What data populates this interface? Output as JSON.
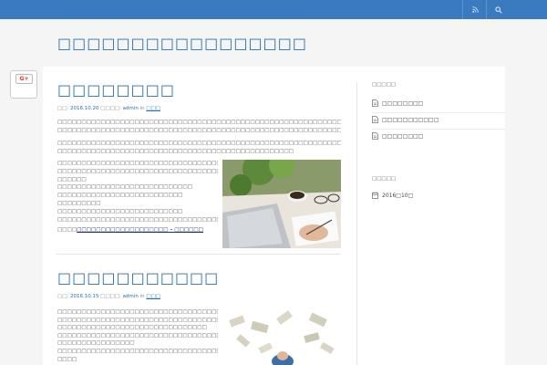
{
  "topbar": {
    "rss_icon": "rss-icon",
    "search_icon": "search-icon"
  },
  "site": {
    "title": "□□□□□□□□□□□□□□□□□"
  },
  "social": {
    "gplus_label": "G+"
  },
  "posts": [
    {
      "title": "□□□□□□□□",
      "date": "2016.10.20",
      "author": "admin",
      "meta_sep": "□□□□:",
      "meta_in": "in",
      "category": "□□□",
      "para1": [
        "□□□□□□□□□□□□□□□□□□□□□□□□□□□□□□□□□□□□□□□□□□□□□□□□□□□□□□□□□□□□□□□□□□□□□□□□□□□□□□□□□□□□",
        "□□□□□□□□□□□□□□□□□□□□□□□□□□□□□□□□□□□□□□□□□□□□□□□□□□□□□□□□□□□□□□□□□□□□"
      ],
      "para2": [
        "□□□□□□□□□□□□□□□□□□□□□□□□□□□□□□□□□□□□□□□□□□□□□□□□□□□□□□□□□□□□□□□□□□□□□□□□□□□□□□□□□□□□",
        "□□□□□□□□□□□□□□□□□□□□□□□□□□□□□□□□□□□□□□□□□□□□□□□□□"
      ],
      "para3": [
        "□□□□□□□□□□□□□□□□□□□□□□□□□□□□□□□□□□□□□",
        "□□□□□□□□□□□□□□□□□□□□□□□□□□□□□□□□□□□□□□□□□□□□□□□□□□□□□",
        "□□□□□□",
        "□□□□□□□□□□□□□□□□□□□□□□□□□□□□",
        "□□□□□□□□□□□□□□□□□□□□□□□□□□",
        "□□□□□□□□□",
        "□□□□□□□□□□□□□□□□□□□□□□□□□□",
        "□□□□□□□□□□□□□□□□□□□□□□□□□□□□□□□□□□□□□□□□□□□□□□□□□□□"
      ],
      "readmore_prefix": "□□□□",
      "readmore_link": "□□□□□□□□□□□□□□□□□□□ – □□□□□□",
      "image_icon": "laptop-desk-photo"
    },
    {
      "title": "□□□□□□□□□□□",
      "date": "2016.10.15",
      "author": "admin",
      "meta_sep": "□□□□:",
      "meta_in": "in",
      "category": "□□□",
      "para1": [
        "□□□□□□□□□□□□□□□□□□□□□□□□□□□□□□□□□□□□□",
        "□□□□□□□□□□□□□□□□□□□□□□□□□□□□□□□□□□□□□□□□□□□□□□□□□□□□□",
        "□□□□□□□□□□□□□□□□□□□□□□□□□□□□□□□",
        "□□□□□□□□□□□□□□□□□□□□□□□□□□□□□□□□□□□□□□□□□□□□□□□□□□□□□",
        "□□□□□□□□□□□□□□□□",
        "□□□□□□□□□□□□□□□□□□□□□□□□□□□□□□□□□□□□□□□□□□□□□□□□□□□□",
        "□□□□"
      ],
      "image_icon": "money-bills-photo"
    }
  ],
  "sidebar": {
    "recent": {
      "title": "□□□□□",
      "items": [
        "□□□□□□□□",
        "□□□□□□□□□□□",
        "□□□□□□□□"
      ]
    },
    "archive": {
      "title": "□□□□□",
      "items": [
        "2016□10□"
      ]
    }
  }
}
